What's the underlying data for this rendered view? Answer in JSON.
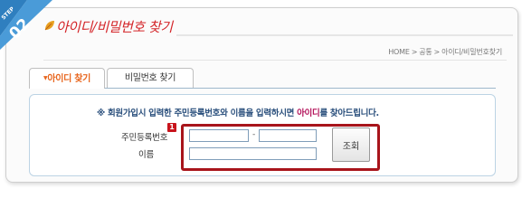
{
  "step": {
    "label": "STEP",
    "number": "02"
  },
  "page": {
    "title": "아이디/비밀번호 찾기"
  },
  "breadcrumb": [
    "HOME",
    "공통",
    "아이디/비밀번호찾기"
  ],
  "tabs": [
    {
      "label": "아이디 찾기",
      "active": true
    },
    {
      "label": "비밀번호 찾기",
      "active": false
    }
  ],
  "form": {
    "notice_prefix": "※ 회원가입시 입력한 주민등록번호와 이름을 입력하시면",
    "notice_highlight": "아이디",
    "notice_suffix": "를 찾아드립니다.",
    "rrn_label": "주민등록번호",
    "name_label": "이름",
    "badge": "1",
    "rrn_separator": "-",
    "rrn_first_value": "",
    "rrn_second_value": "",
    "name_value": "",
    "submit_label": "조회"
  },
  "colors": {
    "step_ribbon": "#3c8fcf",
    "title_red": "#d4262a",
    "active_tab": "#e8661e",
    "notice": "#2a4f7c",
    "highlight": "#b3125a",
    "callout_border": "#a8141b"
  }
}
